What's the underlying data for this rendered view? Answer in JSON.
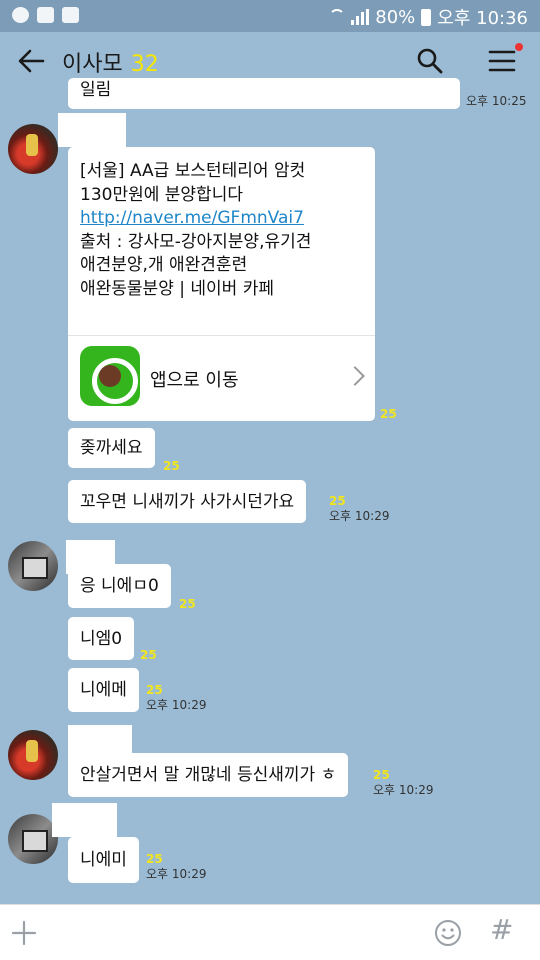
{
  "status_bar": {
    "battery": "80%",
    "time": "오후 10:36"
  },
  "header": {
    "title": "이사모",
    "member_count": "32"
  },
  "messages": {
    "m1": {
      "text": "일림",
      "time": "오후 10:25"
    },
    "link_card": {
      "line1": "[서울] AA급 보스턴테리어 암컷",
      "line2": "130만원에 분양합니다",
      "url": "http://naver.me/GFmnVai7",
      "line3": "출처 : 강사모-강아지분양,유기견",
      "line4": "애견분양,개 애완견훈련",
      "line5": "애완동물분양 | 네이버 카페",
      "app_button": "앱으로 이동",
      "unread": "25"
    },
    "m3": {
      "text": "좆까세요",
      "unread": "25"
    },
    "m4": {
      "text": "꼬우면 니새끼가 사가시던가요",
      "unread": "25",
      "time": "오후 10:29"
    },
    "m5": {
      "text": "응 니에ㅁ0",
      "unread": "25"
    },
    "m6": {
      "text": "니엠0",
      "unread": "25"
    },
    "m7": {
      "text": "니에메",
      "unread": "25",
      "time": "오후 10:29"
    },
    "m8": {
      "text": "안살거면서 말 개많네 등신새끼가 ㅎ",
      "unread": "25",
      "time": "오후 10:29"
    },
    "m9": {
      "text": "니에미",
      "unread": "25",
      "time": "오후 10:29"
    }
  },
  "colors": {
    "background": "#9bbbd4",
    "unread": "#f0e51e",
    "link": "#1c86c8"
  }
}
